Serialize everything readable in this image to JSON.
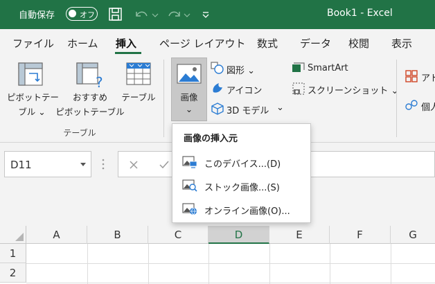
{
  "titlebar": {
    "autosave_label": "自動保存",
    "toggle_state": "オフ",
    "title": "Book1  -  Excel"
  },
  "tabs": [
    "ファイル",
    "ホーム",
    "挿入",
    "ページ レイアウト",
    "数式",
    "データ",
    "校閲",
    "表示"
  ],
  "active_tab": "挿入",
  "ribbon": {
    "pivot_line1": "ピボットテー",
    "pivot_line2": "ブル ⌄",
    "recommended_line1": "おすすめ",
    "recommended_line2": "ピボットテーブル",
    "table": "テーブル",
    "group_tables": "テーブル",
    "image": "画像",
    "image_chevron": "⌄",
    "shapes": "図形 ⌄",
    "icons": "アイコン",
    "models3d": "3D モデル",
    "models3d_chevron": "⌄",
    "smartart": "SmartArt",
    "screenshot": "スクリーンショット ⌄",
    "addins_partial": "アド",
    "personal_partial": "個人"
  },
  "formula_bar": {
    "name_box": "D11"
  },
  "grid": {
    "columns": [
      "A",
      "B",
      "C",
      "D",
      "E",
      "F",
      "G"
    ],
    "selected_column": "D",
    "rows": [
      "1",
      "2"
    ]
  },
  "dropdown": {
    "header": "画像の挿入元",
    "items": [
      {
        "label": "このデバイス...(D)",
        "icon": "device-picture-icon"
      },
      {
        "label": "ストック画像...(S)",
        "icon": "stock-picture-icon"
      },
      {
        "label": "オンライン画像(O)...",
        "icon": "online-picture-icon"
      }
    ]
  },
  "colors": {
    "excel_green": "#217346",
    "ribbon_bg": "#f3f3f3"
  }
}
